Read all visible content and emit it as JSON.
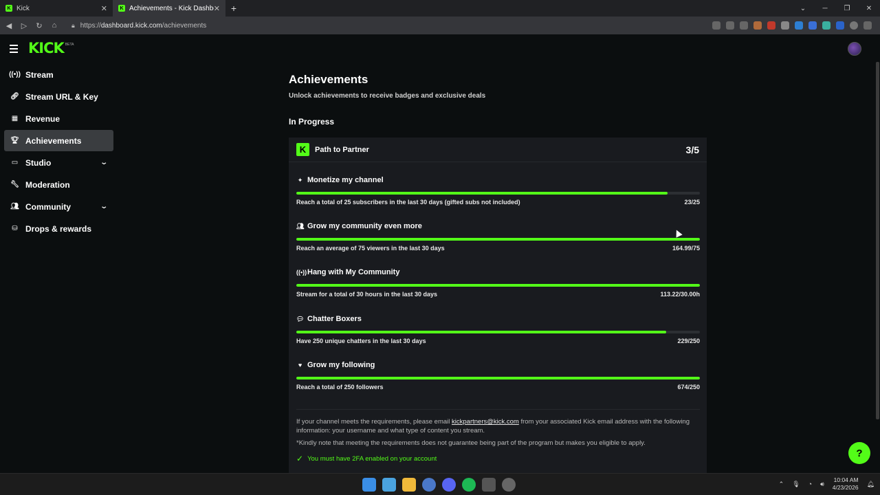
{
  "browser": {
    "tabs": [
      {
        "title": "Kick",
        "active": false
      },
      {
        "title": "Achievements - Kick Dashboard",
        "active": true
      }
    ],
    "url_scheme": "https://",
    "url_host": "dashboard.kick.com",
    "url_path": "/achievements"
  },
  "brand": {
    "logo": "KICK",
    "badge": "BETA"
  },
  "sidebar": {
    "items": [
      {
        "label": "Stream",
        "icon": "broadcast-icon"
      },
      {
        "label": "Stream URL & Key",
        "icon": "link-icon"
      },
      {
        "label": "Revenue",
        "icon": "revenue-icon"
      },
      {
        "label": "Achievements",
        "icon": "trophy-icon",
        "active": true
      },
      {
        "label": "Studio",
        "icon": "studio-icon",
        "expandable": true
      },
      {
        "label": "Moderation",
        "icon": "wrench-icon"
      },
      {
        "label": "Community",
        "icon": "community-icon",
        "expandable": true
      },
      {
        "label": "Drops & rewards",
        "icon": "drops-icon"
      }
    ]
  },
  "page": {
    "title": "Achievements",
    "subtitle": "Unlock achievements to receive badges and exclusive deals",
    "section": "In Progress"
  },
  "card": {
    "title": "Path to Partner",
    "count": "3/5",
    "goals": [
      {
        "name": "Monetize my channel",
        "icon": "sparkle-icon",
        "desc": "Reach a total of 25 subscribers in the last 30 days (gifted subs not included)",
        "value": "23/25",
        "progress": 0.92
      },
      {
        "name": "Grow my community even more",
        "icon": "community-icon",
        "desc": "Reach an average of 75 viewers in the last 30 days",
        "value": "164.99/75",
        "progress": 1.0
      },
      {
        "name": "Hang with My Community",
        "icon": "broadcast-icon",
        "desc": "Stream for a total of 30 hours in the last 30 days",
        "value": "113.22/30.00h",
        "progress": 1.0
      },
      {
        "name": "Chatter Boxers",
        "icon": "chat-icon",
        "desc": "Have 250 unique chatters in the last 30 days",
        "value": "229/250",
        "progress": 0.916
      },
      {
        "name": "Grow my following",
        "icon": "heart-icon",
        "desc": "Reach a total of 250 followers",
        "value": "674/250",
        "progress": 1.0
      }
    ],
    "note_before": "If your channel meets the requirements, please email ",
    "note_email": "kickpartners@kick.com",
    "note_after": " from your associated Kick email address with the following information: your username and what type of content you stream.",
    "note2": "*Kindly note that meeting the requirements does not guarantee being part of the program but makes you eligible to apply.",
    "requirement": "You must have 2FA enabled on your account"
  },
  "taskbar": {
    "time": "10:04 AM",
    "date": "4/23/2026"
  },
  "colors": {
    "accent": "#53fc18",
    "background": "#0b0e0f",
    "card": "#191b1f"
  }
}
